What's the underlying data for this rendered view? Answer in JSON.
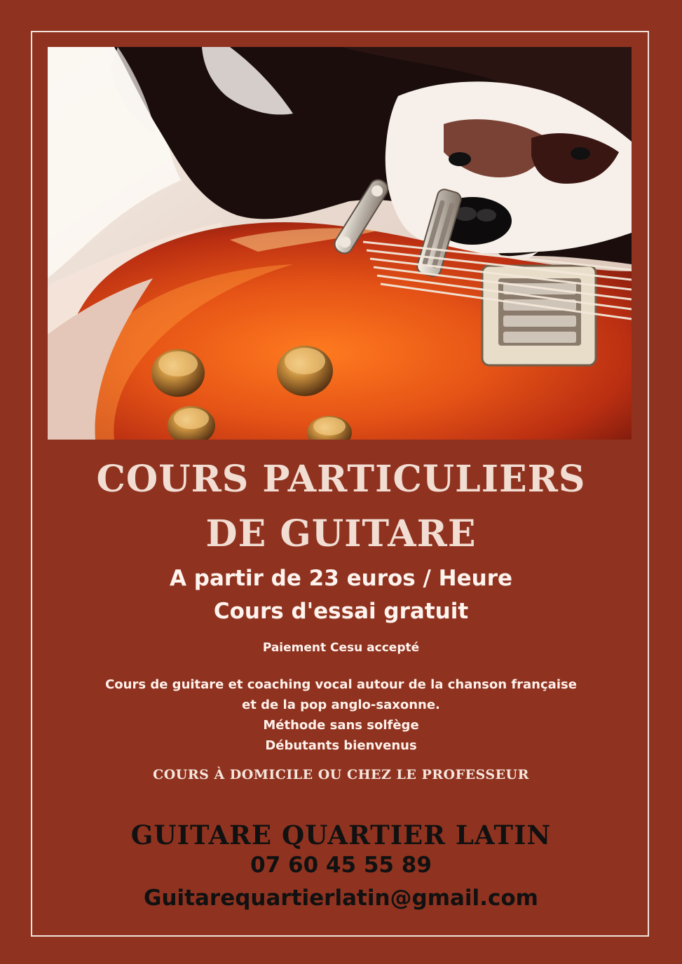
{
  "poster": {
    "title_line1": "COURS PARTICULIERS",
    "title_line2": "DE GUITARE",
    "price": "A partir de 23 euros / Heure",
    "trial": "Cours d'essai gratuit",
    "payment": "Paiement Cesu accepté",
    "description_lines": [
      "Cours de guitare et coaching vocal autour de la chanson française",
      "et de la pop anglo-saxonne.",
      "Méthode sans solfège",
      "Débutants bienvenus"
    ],
    "location": "COURS À DOMICILE OU CHEZ LE PROFESSEUR",
    "brand": "GUITARE QUARTIER LATIN",
    "phone": "07 60 45 55 89",
    "email": "Guitarequartierlatin@gmail.com"
  },
  "colors": {
    "background": "#8f3320",
    "frame": "#f1e2da",
    "headline": "#f2ddd3",
    "body_text": "#fff3ee",
    "contact_text": "#111111"
  },
  "image": {
    "subject": "dog-and-electric-guitar-photo"
  }
}
